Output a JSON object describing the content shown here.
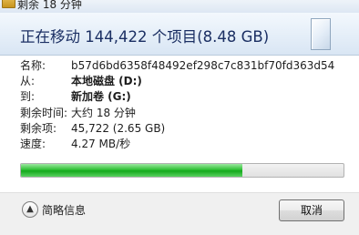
{
  "window": {
    "title": "剩余 18 分钟"
  },
  "header": {
    "heading": "正在移动 144,422 个项目(8.48 GB)",
    "icon": "document-icon"
  },
  "details": [
    {
      "label": "名称:",
      "value": "b57d6bd6358f48492ef298c7c831bf70fd363d54",
      "bold": false
    },
    {
      "label": "从:",
      "value": "本地磁盘 (D:)",
      "bold": true
    },
    {
      "label": "到:",
      "value": "新加卷 (G:)",
      "bold": true
    },
    {
      "label": "剩余时间:",
      "value": "大约 18 分钟",
      "bold": false
    },
    {
      "label": "剩余项:",
      "value": "45,722 (2.65 GB)",
      "bold": false
    },
    {
      "label": "速度:",
      "value": "4.27 MB/秒",
      "bold": false
    }
  ],
  "progress": {
    "fraction": 0.687,
    "color": "#1ead24"
  },
  "footer": {
    "toggle_label": "简略信息",
    "toggle_icon": "chevron-up-icon",
    "cancel_label": "取消"
  }
}
